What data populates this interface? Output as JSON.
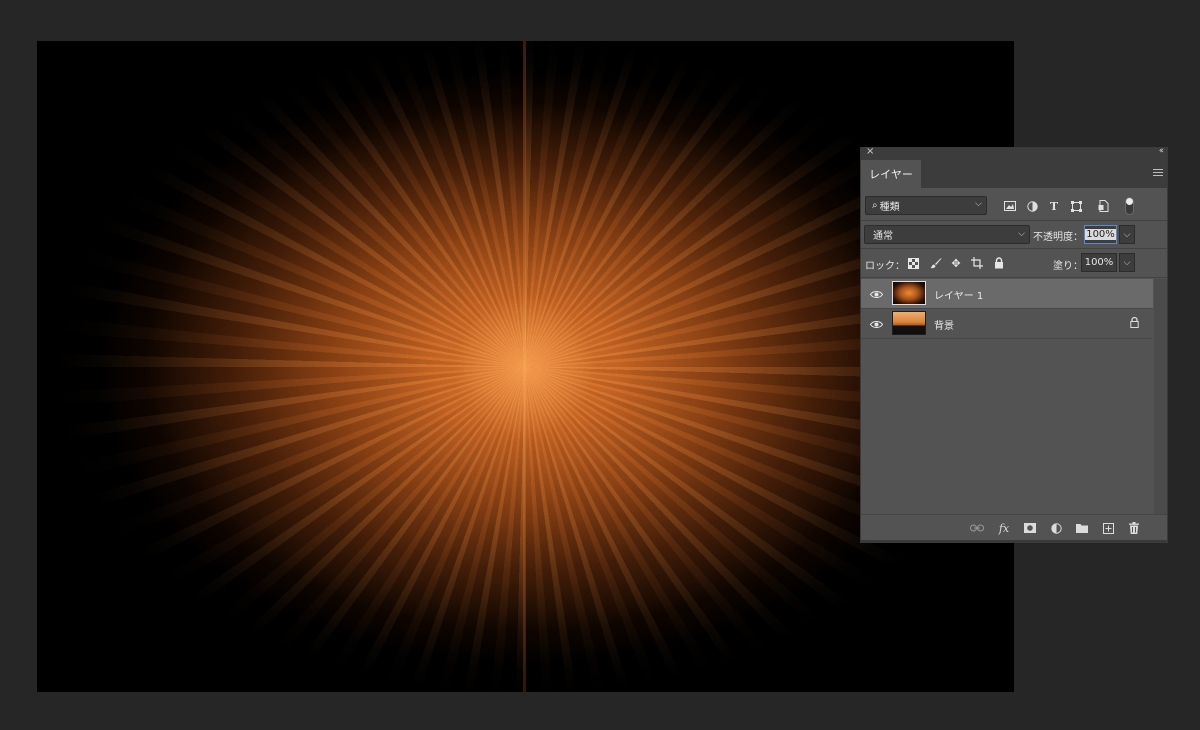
{
  "canvas": {
    "document": "burst-image"
  },
  "panel": {
    "close_glyph": "×",
    "collapse_glyph": "‹‹",
    "tab_label": "レイヤー",
    "filter": {
      "kind_label": "種類",
      "icons": [
        "image-filter-icon",
        "adjustment-filter-icon",
        "type-filter-icon",
        "shape-filter-icon",
        "smart-object-filter-icon"
      ]
    },
    "blend_mode": "通常",
    "opacity_label": "不透明度：",
    "opacity_value": "100%",
    "lock_label": "ロック：",
    "fill_label": "塗り：",
    "fill_value": "100%",
    "layers": [
      {
        "name": "レイヤー 1",
        "selected": true,
        "visible": true,
        "locked": false
      },
      {
        "name": "背景",
        "selected": false,
        "visible": true,
        "locked": true
      }
    ],
    "footer_icons": [
      "link-layers-icon",
      "fx-icon",
      "add-mask-icon",
      "adjustment-layer-icon",
      "new-group-icon",
      "new-layer-icon",
      "delete-layer-icon"
    ],
    "fx_label": "fx"
  },
  "colors": {
    "workspace": "#262626",
    "panel": "#535353",
    "selection": "#6a6a6a",
    "burst": "#f08a35"
  }
}
